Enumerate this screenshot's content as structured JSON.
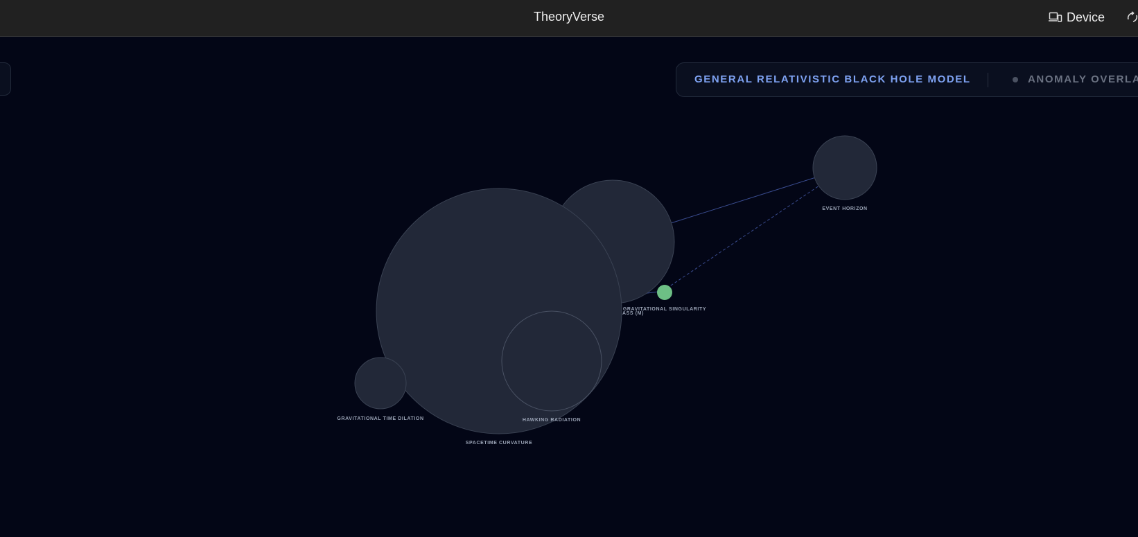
{
  "app": {
    "title": "TheoryVerse",
    "device_label": "Device"
  },
  "model_bar": {
    "title": "GENERAL RELATIVISTIC BLACK HOLE MODEL",
    "overlay_label": "ANOMALY OVERLAY"
  },
  "graph": {
    "nodes": [
      {
        "id": "mass",
        "label": "ASS (M)"
      },
      {
        "id": "spacetime-curvature",
        "label": "SPACETIME CURVATURE"
      },
      {
        "id": "event-horizon",
        "label": "EVENT HORIZON"
      },
      {
        "id": "gravitational-singularity",
        "label": "GRAVITATIONAL SINGULARITY"
      },
      {
        "id": "hawking-radiation",
        "label": "HAWKING RADIATION"
      },
      {
        "id": "gravitational-time-dilation",
        "label": "GRAVITATIONAL TIME DILATION"
      }
    ],
    "colors": {
      "node_fill": "#222838",
      "node_stroke": "#3a4253",
      "singularity_fill": "#6dbf85",
      "edge_solid": "#3a4c8f",
      "edge_dashed": "#3a4c8f",
      "background": "#030616"
    }
  }
}
